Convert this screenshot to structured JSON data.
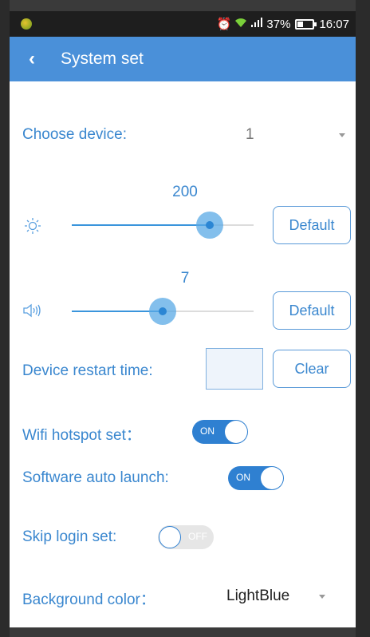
{
  "status_bar": {
    "battery_percent": "37%",
    "time": "16:07",
    "alarm_icon": "alarm-icon",
    "wifi_icon": "wifi-icon",
    "signal_icon": "signal-icon",
    "battery_icon": "battery-icon"
  },
  "app_bar": {
    "back_icon": "back-chevron-icon",
    "title": "System set",
    "color": "#4a90d9"
  },
  "device": {
    "label": "Choose device:",
    "value": "1"
  },
  "brightness": {
    "value": "200",
    "level": 0.76,
    "icon": "sun-icon",
    "default_label": "Default"
  },
  "volume": {
    "value": "7",
    "level": 0.5,
    "icon": "speaker-icon",
    "default_label": "Default"
  },
  "restart": {
    "label": "Device restart time:",
    "value": "",
    "clear_label": "Clear"
  },
  "wifi_hotspot": {
    "label": "Wifi hotspot set：",
    "state": "ON"
  },
  "auto_launch": {
    "label": "Software auto launch:",
    "state": "ON"
  },
  "skip_login": {
    "label": "Skip login set:",
    "state": "OFF"
  },
  "background_color": {
    "label": "Background color：",
    "value": "LightBlue"
  },
  "accent_color": "#3a87cf"
}
